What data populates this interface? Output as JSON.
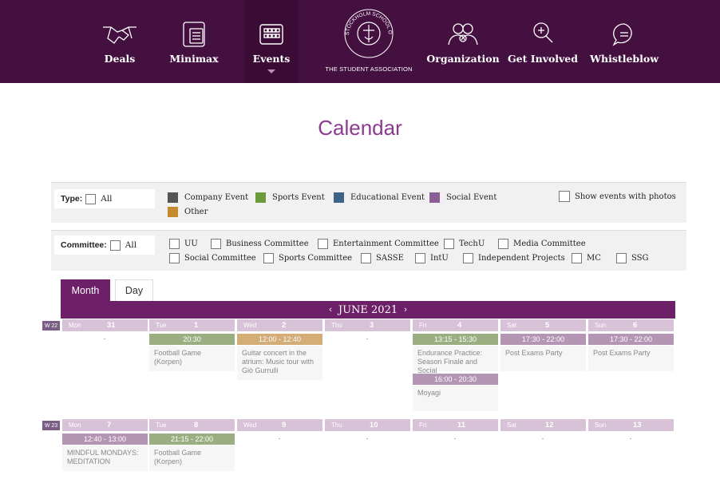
{
  "nav": {
    "items": [
      {
        "label": "Deals",
        "icon": "handshake-icon"
      },
      {
        "label": "Minimax",
        "icon": "phone-card-icon"
      },
      {
        "label": "Events",
        "icon": "calendar-grid-icon"
      },
      {
        "label": "Organization",
        "icon": "people-icon"
      },
      {
        "label": "Get Involved",
        "icon": "search-plus-icon"
      },
      {
        "label": "Whistleblow",
        "icon": "chat-bubble-icon"
      }
    ],
    "logo_text": "STOCKHOLM SCHOOL OF ECONOMICS",
    "logo_sub": "THE STUDENT ASSOCIATION"
  },
  "page_title": "Calendar",
  "filters": {
    "type_label": "Type:",
    "all_label": "All",
    "types": [
      {
        "label": "Company Event",
        "color": "#555555"
      },
      {
        "label": "Sports Event",
        "color": "#6a9a3a"
      },
      {
        "label": "Educational Event",
        "color": "#3d6386"
      },
      {
        "label": "Social Event",
        "color": "#8a5f96"
      },
      {
        "label": "Other",
        "color": "#c58a2b"
      }
    ],
    "photos_label": "Show events with photos",
    "committee_label": "Committee:",
    "committees": [
      "UU",
      "Business Committee",
      "Entertainment Committee",
      "TechU",
      "Media Committee",
      "Social Committee",
      "Sports Committee",
      "SASSE",
      "IntU",
      "Independent Projects",
      "MC",
      "SSG"
    ]
  },
  "tabs": {
    "month": "Month",
    "day": "Day"
  },
  "calendar": {
    "month_label": "JUNE 2021",
    "prev_arrow": "‹",
    "next_arrow": "›",
    "weeks": [
      {
        "label": "W 22",
        "days": [
          {
            "name": "Mon",
            "num": "31",
            "events": []
          },
          {
            "name": "Tue",
            "num": "1",
            "events": [
              {
                "time": "20:30",
                "title": "Football Game (Korpen)",
                "color": "#9aae82"
              }
            ]
          },
          {
            "name": "Wed",
            "num": "2",
            "events": [
              {
                "time": "12:00 - 12:40",
                "title": "Guitar concert in the atrium: Music tour with Giò Gurrulli",
                "color": "#d3ac76"
              }
            ]
          },
          {
            "name": "Thu",
            "num": "3",
            "events": []
          },
          {
            "name": "Fri",
            "num": "4",
            "events": [
              {
                "time": "13:15 - 15:30",
                "title": "Endurance Practice: Season Finale and Social",
                "color": "#9aae82"
              },
              {
                "time": "16:00 - 20:30",
                "title": "Moyagi",
                "color": "#b495b4"
              }
            ]
          },
          {
            "name": "Sat",
            "num": "5",
            "events": [
              {
                "time": "17:30 - 22:00",
                "title": "Post Exams Party",
                "color": "#b495b4"
              }
            ]
          },
          {
            "name": "Sun",
            "num": "6",
            "events": [
              {
                "time": "17:30 - 22:00",
                "title": "Post Exams Party",
                "color": "#b495b4"
              }
            ]
          }
        ]
      },
      {
        "label": "W 23",
        "days": [
          {
            "name": "Mon",
            "num": "7",
            "events": [
              {
                "time": "12:40 - 13:00",
                "title": "MINDFUL MONDAYS: MEDITATION",
                "color": "#b495b4"
              }
            ]
          },
          {
            "name": "Tue",
            "num": "8",
            "events": [
              {
                "time": "21:15 - 22:00",
                "title": "Football Game (Korpen)",
                "color": "#9aae82"
              }
            ]
          },
          {
            "name": "Wed",
            "num": "9",
            "events": []
          },
          {
            "name": "Thu",
            "num": "10",
            "events": []
          },
          {
            "name": "Fri",
            "num": "11",
            "events": []
          },
          {
            "name": "Sat",
            "num": "12",
            "events": []
          },
          {
            "name": "Sun",
            "num": "13",
            "events": []
          }
        ]
      }
    ],
    "empty_marker": "-"
  }
}
